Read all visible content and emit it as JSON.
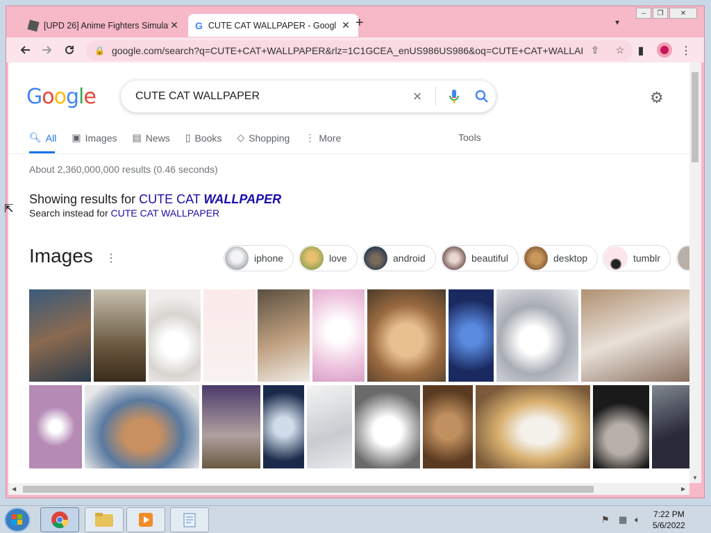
{
  "browser": {
    "tabs": [
      {
        "title": "[UPD 26] Anime Fighters Simulat",
        "close": "✕",
        "active": false
      },
      {
        "title": "CUTE CAT WALLPAPER - Googl",
        "close": "✕",
        "active": true
      }
    ],
    "new_tab": "+",
    "tab_search_icon": "chevron-down",
    "window_controls": [
      "minimize",
      "restore",
      "close"
    ],
    "url": "google.com/search?q=CUTE+CAT+WALLPAPER&rlz=1C1GCEA_enUS986US986&oq=CUTE+CAT+WALLAP..."
  },
  "google": {
    "logo": [
      "G",
      "o",
      "o",
      "g",
      "l",
      "e"
    ],
    "logo_colors": [
      "#4285f4",
      "#ea4335",
      "#fbbc05",
      "#4285f4",
      "#34a853",
      "#ea4335"
    ],
    "query": "CUTE CAT WALLPAPER",
    "tabs": [
      {
        "label": "All",
        "icon": "search-icon",
        "active": true
      },
      {
        "label": "Images",
        "icon": "image-icon",
        "active": false
      },
      {
        "label": "News",
        "icon": "news-icon",
        "active": false
      },
      {
        "label": "Books",
        "icon": "book-icon",
        "active": false
      },
      {
        "label": "Shopping",
        "icon": "tag-icon",
        "active": false
      },
      {
        "label": "More",
        "icon": "vertical-dots-icon",
        "active": false
      }
    ],
    "tools": "Tools",
    "stats": "About 2,360,000,000 results (0.46 seconds)",
    "showing_prefix": "Showing results for ",
    "showing_plain": "CUTE CAT ",
    "showing_bold": "WALLPAPER",
    "instead_prefix": "Search instead for ",
    "instead_link": "CUTE CAT WALLPAPER",
    "images_heading": "Images",
    "chips": [
      "iphone",
      "love",
      "android",
      "beautiful",
      "desktop",
      "tumblr"
    ],
    "accent": "#1a73e8",
    "link_color": "#1a0dab"
  },
  "taskbar": {
    "time": "7:22 PM",
    "date": "5/6/2022",
    "apps": [
      "chrome",
      "explorer",
      "media-player",
      "notepad"
    ]
  }
}
